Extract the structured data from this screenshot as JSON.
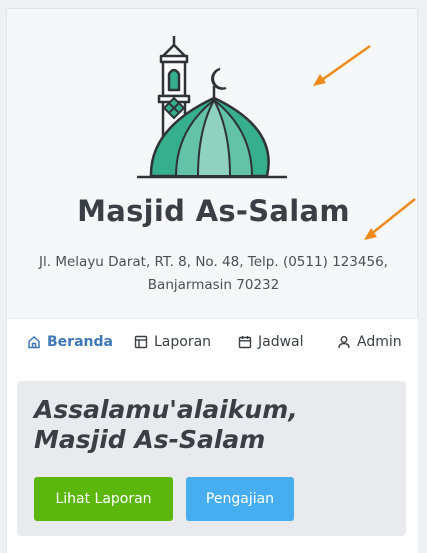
{
  "site": {
    "name": "Masjid As-Salam",
    "address": "Jl. Melayu Darat, RT. 8, No. 48, Telp. (0511) 123456, Banjarmasin 70232"
  },
  "nav": {
    "items": [
      {
        "label": "Beranda",
        "icon": "home-icon",
        "active": true
      },
      {
        "label": "Laporan",
        "icon": "table-icon",
        "active": false
      },
      {
        "label": "Jadwal",
        "icon": "calendar-icon",
        "active": false
      },
      {
        "label": "Admin",
        "icon": "user-icon",
        "active": false
      }
    ]
  },
  "hero": {
    "greeting_line1": "Assalamu'alaikum,",
    "greeting_line2": "Masjid As-Salam",
    "primary_button": "Lihat Laporan",
    "secondary_button": "Pengajian"
  },
  "colors": {
    "accent_green": "#5cb70d",
    "accent_blue": "#45adf0",
    "nav_active": "#3f78b8",
    "dome_green": "#36b08c",
    "arrow_orange": "#ee8a1a"
  }
}
